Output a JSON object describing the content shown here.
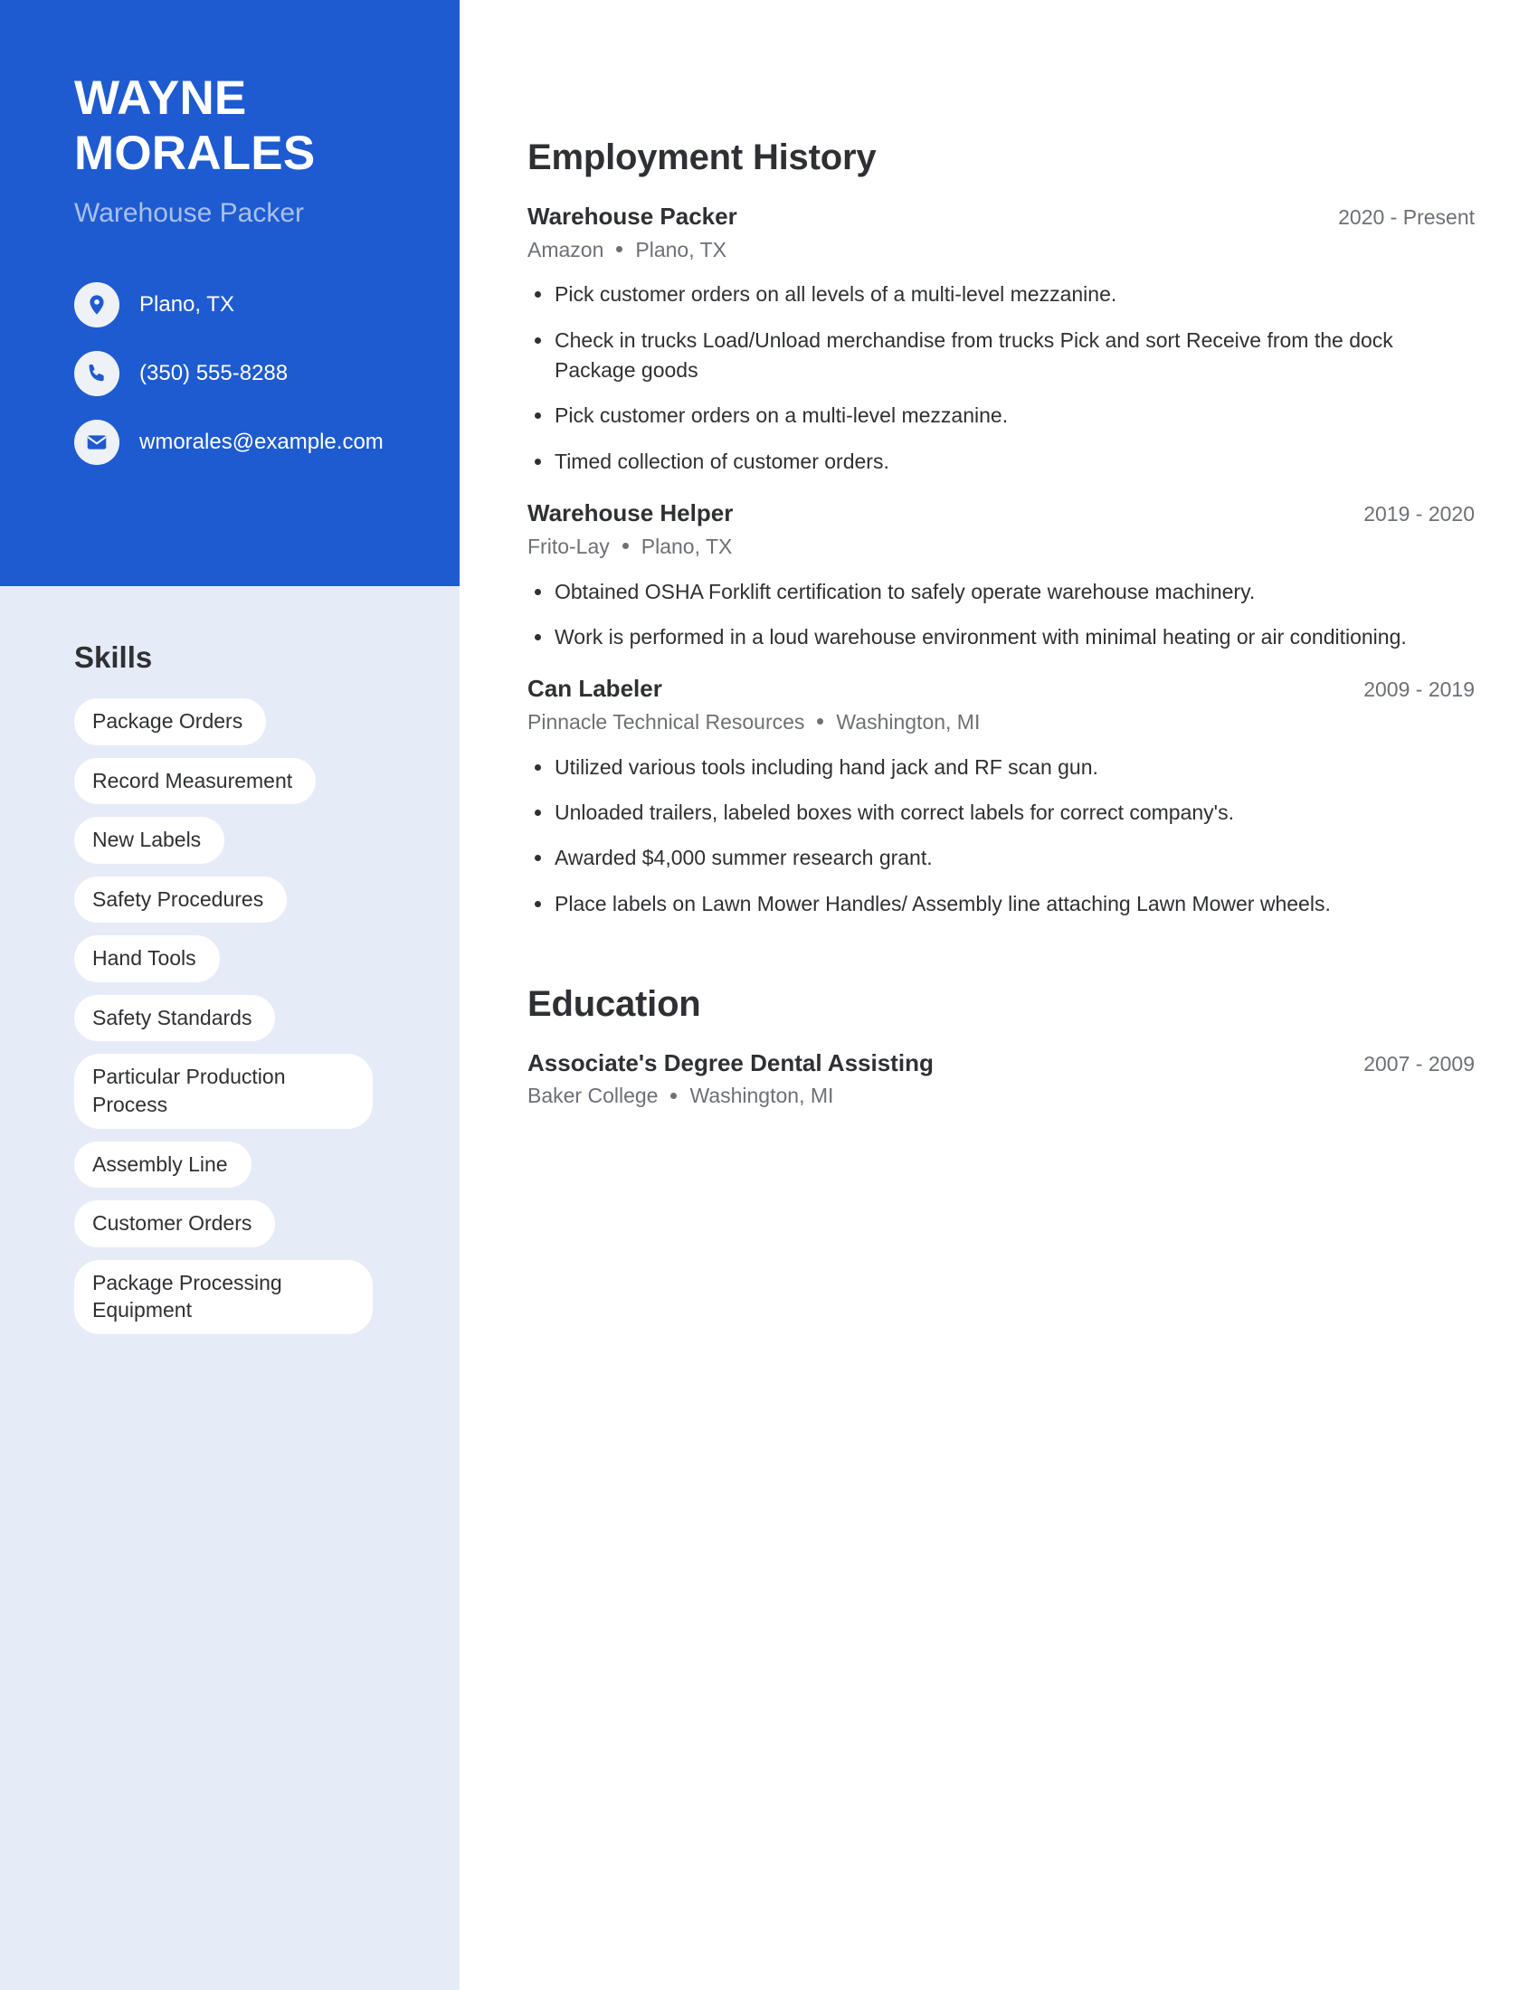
{
  "profile": {
    "first_name": "WAYNE",
    "last_name": "MORALES",
    "headline": "Warehouse Packer"
  },
  "contact": {
    "location": "Plano, TX",
    "phone": "(350) 555-8288",
    "email": "wmorales@example.com",
    "icons": {
      "location": "location-pin-icon",
      "phone": "phone-icon",
      "email": "envelope-icon"
    }
  },
  "sidebar": {
    "skills_title": "Skills",
    "skills": [
      "Package Orders",
      "Record Measurement",
      "New Labels",
      "Safety Procedures",
      "Hand Tools",
      "Safety Standards",
      "Particular Production Process",
      "Assembly Line",
      "Customer Orders",
      "Package Processing Equipment"
    ]
  },
  "employment": {
    "title": "Employment History",
    "entries": [
      {
        "role": "Warehouse Packer",
        "dates": "2020 - Present",
        "company": "Amazon",
        "location": "Plano, TX",
        "bullets": [
          "Pick customer orders on all levels of a multi-level mezzanine.",
          "Check in trucks Load/Unload merchandise from trucks Pick and sort Receive from the dock Package goods",
          "Pick customer orders on a multi-level mezzanine.",
          "Timed collection of customer orders."
        ]
      },
      {
        "role": "Warehouse Helper",
        "dates": "2019 - 2020",
        "company": "Frito-Lay",
        "location": "Plano, TX",
        "bullets": [
          "Obtained OSHA Forklift certification to safely operate warehouse machinery.",
          "Work is performed in a loud warehouse environment with minimal heating or air conditioning."
        ]
      },
      {
        "role": "Can Labeler",
        "dates": "2009 - 2019",
        "company": "Pinnacle Technical Resources",
        "location": "Washington, MI",
        "bullets": [
          "Utilized various tools including hand jack and RF scan gun.",
          "Unloaded trailers, labeled boxes with correct labels for correct company's.",
          "Awarded $4,000 summer research grant.",
          "Place labels on Lawn Mower Handles/ Assembly line attaching Lawn Mower wheels."
        ]
      }
    ]
  },
  "education": {
    "title": "Education",
    "entries": [
      {
        "degree": "Associate's Degree Dental Assisting",
        "dates": "2007 - 2009",
        "school": "Baker College",
        "location": "Washington, MI"
      }
    ]
  },
  "colors": {
    "accent_blue": "#1f5bd0",
    "sidebar_light": "#e6ebf8",
    "headline_blue": "#a8c0ea",
    "text_dark": "#2e3033",
    "text_muted": "#6d7075",
    "pill_white": "#ffffff"
  }
}
